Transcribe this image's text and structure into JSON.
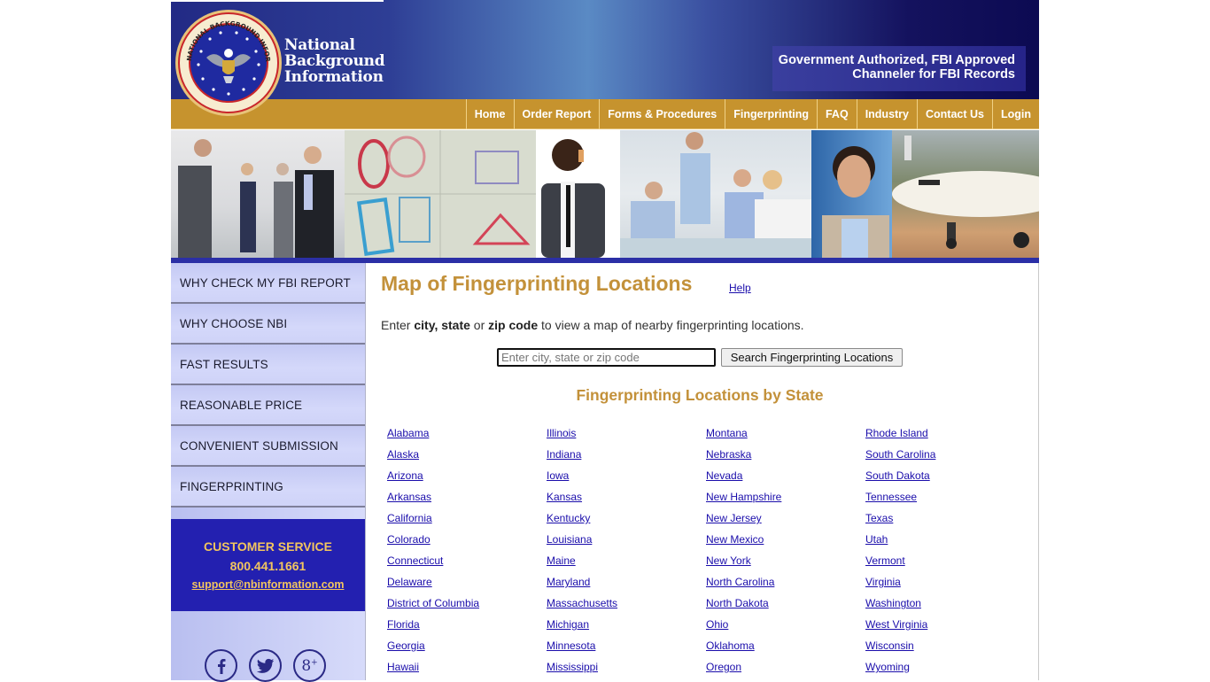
{
  "header": {
    "brand_lines": [
      "National",
      "Background",
      "Information"
    ],
    "seal_text": "NATIONAL BACKGROUND INFORMATION",
    "tagline_lines": [
      "Government Authorized, FBI Approved",
      "Channeler for FBI Records"
    ]
  },
  "nav": {
    "items": [
      {
        "label": "Home"
      },
      {
        "label": "Order Report"
      },
      {
        "label": "Forms & Procedures"
      },
      {
        "label": "Fingerprinting"
      },
      {
        "label": "FAQ"
      },
      {
        "label": "Industry"
      },
      {
        "label": "Contact Us"
      },
      {
        "label": "Login"
      }
    ]
  },
  "banner": {
    "photos": [
      {
        "name": "business-handshake-photo"
      },
      {
        "name": "passport-stamps-photo"
      },
      {
        "name": "businessman-phone-photo"
      },
      {
        "name": "office-meeting-photo"
      },
      {
        "name": "smiling-woman-photo"
      },
      {
        "name": "airplane-photo"
      }
    ]
  },
  "sidebar": {
    "items": [
      {
        "label": "WHY CHECK MY FBI REPORT"
      },
      {
        "label": "WHY CHOOSE NBI"
      },
      {
        "label": "FAST RESULTS"
      },
      {
        "label": "REASONABLE PRICE"
      },
      {
        "label": "CONVENIENT SUBMISSION"
      },
      {
        "label": "FINGERPRINTING"
      }
    ],
    "customer_service": {
      "title": "CUSTOMER SERVICE",
      "phone": "800.441.1661",
      "email": "support@nbinformation.com"
    },
    "social": [
      {
        "icon": "facebook-icon",
        "glyph": "f"
      },
      {
        "icon": "twitter-icon",
        "glyph": "t"
      },
      {
        "icon": "google-plus-icon",
        "glyph": "g+"
      }
    ]
  },
  "main": {
    "title": "Map of Fingerprinting Locations",
    "help_link": "Help",
    "intro": {
      "prefix": "Enter ",
      "bold1": "city, state",
      "mid": " or ",
      "bold2": "zip code",
      "suffix": " to view a map of nearby fingerprinting locations."
    },
    "search": {
      "placeholder": "Enter city, state or zip code",
      "value": "",
      "button_label": "Search Fingerprinting Locations"
    },
    "states_title": "Fingerprinting Locations by State",
    "state_columns": [
      [
        "Alabama",
        "Alaska",
        "Arizona",
        "Arkansas",
        "California",
        "Colorado",
        "Connecticut",
        "Delaware",
        "District of Columbia",
        "Florida",
        "Georgia",
        "Hawaii"
      ],
      [
        "Illinois",
        "Indiana",
        "Iowa",
        "Kansas",
        "Kentucky",
        "Louisiana",
        "Maine",
        "Maryland",
        "Massachusetts",
        "Michigan",
        "Minnesota",
        "Mississippi"
      ],
      [
        "Montana",
        "Nebraska",
        "Nevada",
        "New Hampshire",
        "New Jersey",
        "New Mexico",
        "New York",
        "North Carolina",
        "North Dakota",
        "Ohio",
        "Oklahoma",
        "Oregon"
      ],
      [
        "Rhode Island",
        "South Carolina",
        "South Dakota",
        "Tennessee",
        "Texas",
        "Utah",
        "Vermont",
        "Virginia",
        "Washington",
        "West Virginia",
        "Wisconsin",
        "Wyoming"
      ]
    ]
  },
  "colors": {
    "header_blue": "#222a85",
    "nav_gold": "#c6932e",
    "title_gold": "#c3913a",
    "link_blue": "#1a0dab",
    "cs_blue": "#2320b0",
    "cs_gold": "#f2c55f",
    "sidebar_lavender": "#c8cdf6"
  }
}
